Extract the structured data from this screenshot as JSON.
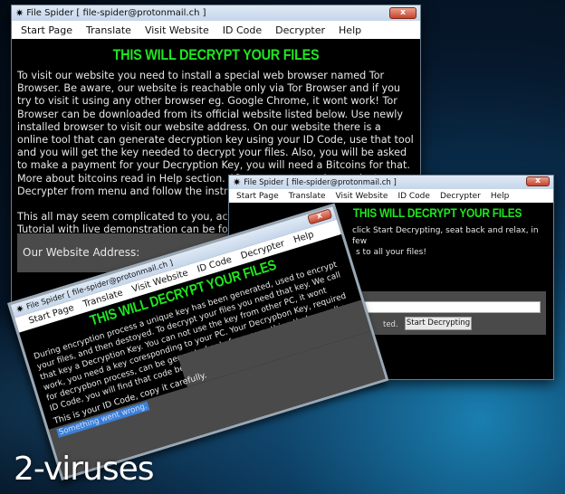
{
  "windows": [
    {
      "title": "File Spider [ file-spider@protonmail.ch ]",
      "close_label": "x",
      "menu": [
        "Start Page",
        "Translate",
        "Visit Website",
        "ID Code",
        "Decrypter",
        "Help"
      ],
      "heading": "THIS WILL DECRYPT YOUR FILES",
      "paragraph": "To visit our website you need to install a special web browser named Tor Browser. Be aware, our website is reachable only via Tor Browser and if you try to visit it using any other browser eg. Google Chrome, it wont work! Tor Browser can be downloaded from its official website listed below. Use newly installed browser to visit our website address. On our website there is a online tool that can generate decryption key using your ID Code, use that tool and you will get the key needed to decrypt your files. Also, you will be asked to make a payment for your Decryption Key, you will need a Bitcoins for that. More about bitcoins read in Help section. After you get your key, select Decrypter from menu and follow the instructions provided on that page.",
      "paragraph2_line1": "This all may seem complicated to you, actual",
      "paragraph2_line2": "Tutorial with live demonstration can be found",
      "address_label": "Our Website Address:"
    },
    {
      "title": "File Spider [ file-spider@protonmail.ch ]",
      "close_label": "x",
      "menu": [
        "Start Page",
        "Translate",
        "Visit Website",
        "ID Code",
        "Decrypter",
        "Help"
      ],
      "heading": "THIS WILL DECRYPT YOUR FILES",
      "line1": "click Start Decrypting, seat back and relax, in few",
      "line2": "s to all your files!",
      "status_fragment": "ted.",
      "key_input_value": "",
      "start_button": "Start Decrypting"
    },
    {
      "title": "File Spider [ file-spider@protonmail.ch ]",
      "close_label": "x",
      "menu": [
        "Start Page",
        "Translate",
        "Visit Website",
        "ID Code",
        "Decrypter",
        "Help"
      ],
      "heading": "THIS WILL DECRYPT YOUR FILES",
      "paragraph": "During encryption process a unique key has been generated, used to encrypt your files, and then destoyed. To decrypt your files you need that key. We call that key a Decryption Key. You can not use the key from other PC, it wont work, you need a key coresponding to your PC. Your Decrypbon Key, required for decrypbon process, can be generated only from something that we call a ID Code, you will find that code below.",
      "id_label": "This is your ID Code, copy it carefully.",
      "id_value": "Something went wrong."
    }
  ],
  "watermark": "2-viruses"
}
